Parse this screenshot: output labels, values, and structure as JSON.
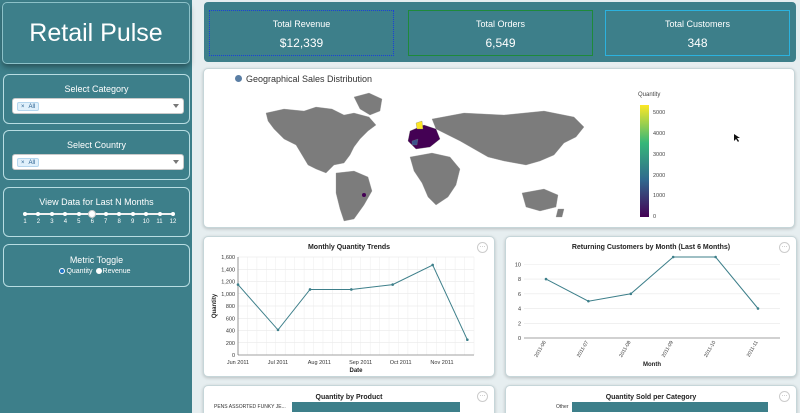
{
  "app": {
    "title": "Retail Pulse"
  },
  "filters": {
    "category": {
      "title": "Select Category",
      "chip": "All"
    },
    "country": {
      "title": "Select Country",
      "chip": "All"
    },
    "months": {
      "title": "View Data for Last N Months",
      "marks": [
        "1",
        "2",
        "3",
        "4",
        "5",
        "6",
        "7",
        "8",
        "9",
        "10",
        "11",
        "12"
      ],
      "value": 6
    },
    "metric": {
      "title": "Metric Toggle",
      "options": [
        "Quantity",
        "Revenue"
      ],
      "selected": "Revenue"
    }
  },
  "kpis": [
    {
      "label": "Total Revenue",
      "value": "$12,339",
      "color": "#1a3fd9"
    },
    {
      "label": "Total Orders",
      "value": "6,549",
      "color": "#1e8a3a"
    },
    {
      "label": "Total Customers",
      "value": "348",
      "color": "#2bb2df"
    }
  ],
  "map": {
    "title": "Geographical Sales Distribution",
    "legend_title": "Quantity",
    "legend_ticks": [
      "5000",
      "4000",
      "3000",
      "2000",
      "1000",
      "0"
    ],
    "colorscale": [
      "#440154",
      "#31688e",
      "#35b779",
      "#fde725"
    ]
  },
  "charts": {
    "monthly": {
      "title": "Monthly Quantity Trends",
      "xlabel": "Date",
      "ylabel": "Quantity",
      "more_label": "···"
    },
    "returning": {
      "title": "Returning Customers by Month (Last 6 Months)",
      "xlabel": "Month",
      "more_label": "···"
    },
    "product": {
      "title": "Quantity by Product",
      "more_label": "···"
    },
    "category": {
      "title": "Quantity Sold per Category",
      "more_label": "···"
    }
  },
  "chart_data": [
    {
      "type": "line",
      "title": "Monthly Quantity Trends",
      "x": [
        "Jun 2011",
        "Jul 2011",
        "Aug 2011",
        "Sep 2011",
        "Oct 2011",
        "Nov 2011"
      ],
      "x_dates": [
        "2011-06",
        "2011-07",
        "2011-08",
        "2011-09",
        "2011-10",
        "2011-11"
      ],
      "values": [
        1150,
        410,
        1070,
        1070,
        1150,
        1470,
        250
      ],
      "points_x": [
        "2011-06-01",
        "2011-07-01",
        "2011-07-25",
        "2011-08-25",
        "2011-09-25",
        "2011-10-25",
        "2011-11-20"
      ],
      "ylim": [
        0,
        1600
      ],
      "yticks": [
        "0",
        "200",
        "400",
        "600",
        "800",
        "1,000",
        "1,200",
        "1,400",
        "1,600"
      ],
      "xlabel": "Date",
      "ylabel": "Quantity",
      "color": "#3d7f8a"
    },
    {
      "type": "line",
      "title": "Returning Customers by Month (Last 6 Months)",
      "categories": [
        "2011-06",
        "2011-07",
        "2011-08",
        "2011-09",
        "2011-10",
        "2011-11"
      ],
      "values": [
        8,
        5,
        6,
        11,
        11,
        4
      ],
      "ylim": [
        0,
        11
      ],
      "yticks": [
        "0",
        "2",
        "4",
        "6",
        "8",
        "10"
      ],
      "xlabel": "Month",
      "color": "#3d7f8a"
    },
    {
      "type": "bar",
      "title": "Quantity by Product",
      "categories": [
        "PENS ASSORTED FUNKY JE..."
      ],
      "color": "#3d7f8a"
    },
    {
      "type": "bar",
      "title": "Quantity Sold per Category",
      "categories": [
        "Other"
      ],
      "color": "#3d7f8a"
    }
  ]
}
